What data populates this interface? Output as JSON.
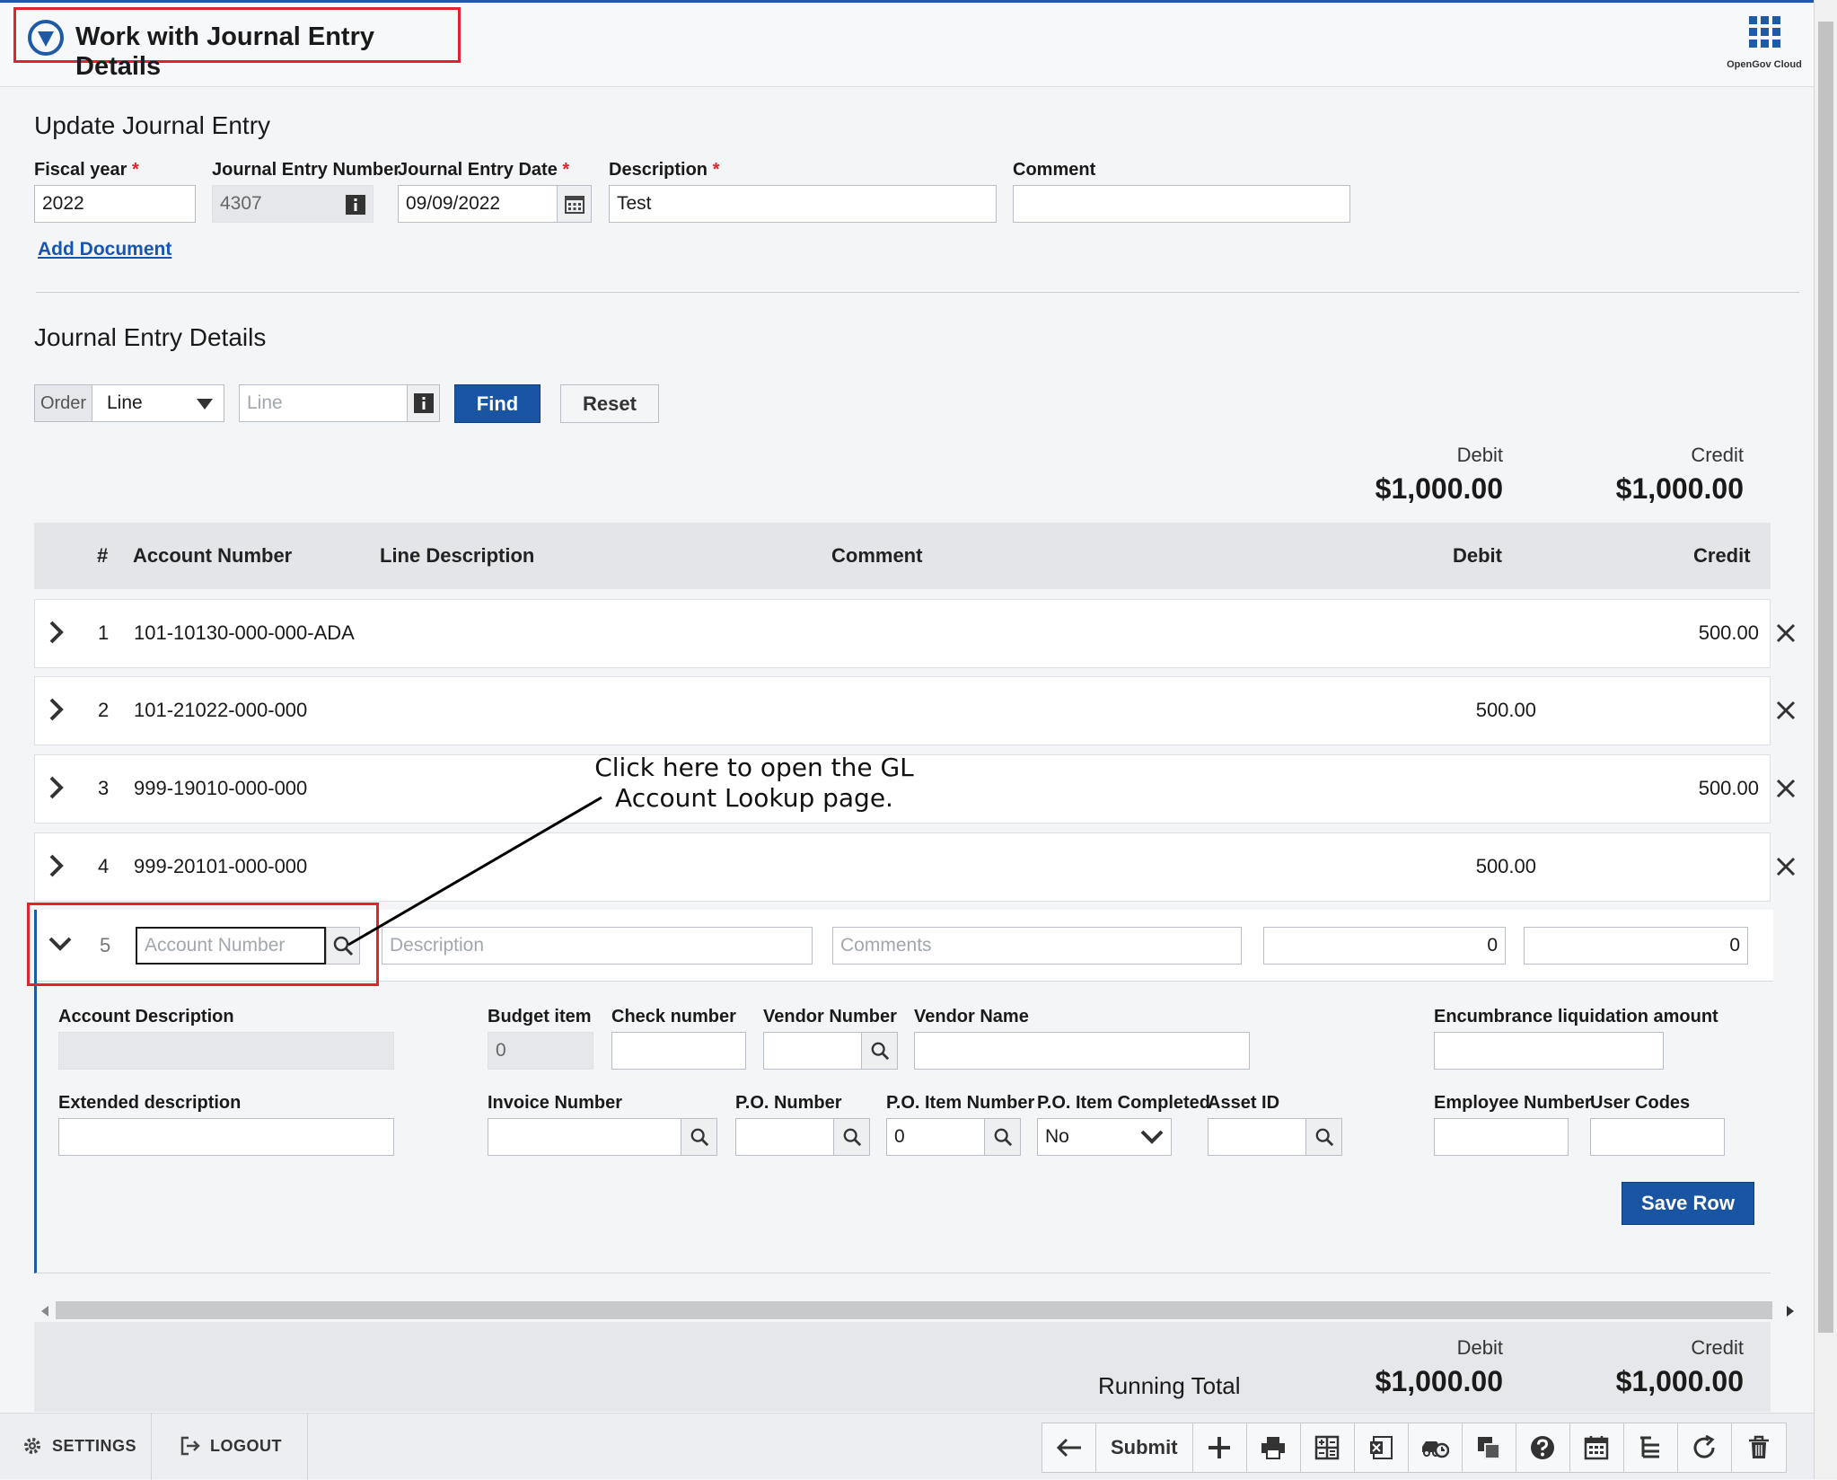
{
  "app": {
    "title": "Work with Journal Entry Details",
    "apps_label": "OpenGov Cloud"
  },
  "update": {
    "section_title": "Update Journal Entry",
    "fiscal_year": {
      "label": "Fiscal year",
      "required": "*",
      "value": "2022"
    },
    "je_number": {
      "label": "Journal Entry Number",
      "value": "4307"
    },
    "je_date": {
      "label": "Journal Entry Date",
      "required": "*",
      "value": "09/09/2022"
    },
    "description": {
      "label": "Description",
      "required": "*",
      "value": "Test"
    },
    "comment": {
      "label": "Comment",
      "value": ""
    },
    "add_document": "Add Document"
  },
  "details": {
    "section_title": "Journal Entry Details",
    "order_label": "Order",
    "order_value": "Line",
    "line_placeholder": "Line",
    "find": "Find",
    "reset": "Reset",
    "totals": {
      "debit_label": "Debit",
      "debit": "$1,000.00",
      "credit_label": "Credit",
      "credit": "$1,000.00"
    }
  },
  "table": {
    "headers": {
      "num": "#",
      "account": "Account Number",
      "line_desc": "Line Description",
      "comment": "Comment",
      "debit": "Debit",
      "credit": "Credit"
    },
    "rows": [
      {
        "num": "1",
        "account": "101-10130-000-000-ADA",
        "debit": "",
        "credit": "500.00"
      },
      {
        "num": "2",
        "account": "101-21022-000-000",
        "debit": "500.00",
        "credit": ""
      },
      {
        "num": "3",
        "account": "999-19010-000-000",
        "debit": "",
        "credit": "500.00"
      },
      {
        "num": "4",
        "account": "999-20101-000-000",
        "debit": "500.00",
        "credit": ""
      }
    ],
    "new_row": {
      "num": "5",
      "account_placeholder": "Account Number",
      "description_placeholder": "Description",
      "comments_placeholder": "Comments",
      "debit": "0",
      "credit": "0"
    }
  },
  "expanded": {
    "account_description": "Account Description",
    "budget_item": {
      "label": "Budget item",
      "value": "0"
    },
    "check_number": "Check number",
    "vendor_number": "Vendor Number",
    "vendor_name": "Vendor Name",
    "encumbrance": "Encumbrance liquidation amount",
    "extended_description": "Extended description",
    "invoice_number": "Invoice Number",
    "po_number": "P.O. Number",
    "po_item_number": {
      "label": "P.O. Item Number",
      "value": "0"
    },
    "po_item_completed": {
      "label": "P.O. Item Completed",
      "value": "No"
    },
    "asset_id": "Asset ID",
    "employee_number": "Employee Number",
    "user_codes": "User Codes",
    "save_row": "Save Row"
  },
  "callout": {
    "line1": "Click here to open the GL",
    "line2": "Account Lookup page."
  },
  "running_total": {
    "label": "Running Total",
    "debit_label": "Debit",
    "debit": "$1,000.00",
    "credit_label": "Credit",
    "credit": "$1,000.00"
  },
  "bottombar": {
    "settings": "SETTINGS",
    "logout": "LOGOUT",
    "submit": "Submit"
  },
  "colors": {
    "primary": "#1a55a3",
    "highlight": "#e0242c",
    "accent": "#1f5aa6"
  }
}
